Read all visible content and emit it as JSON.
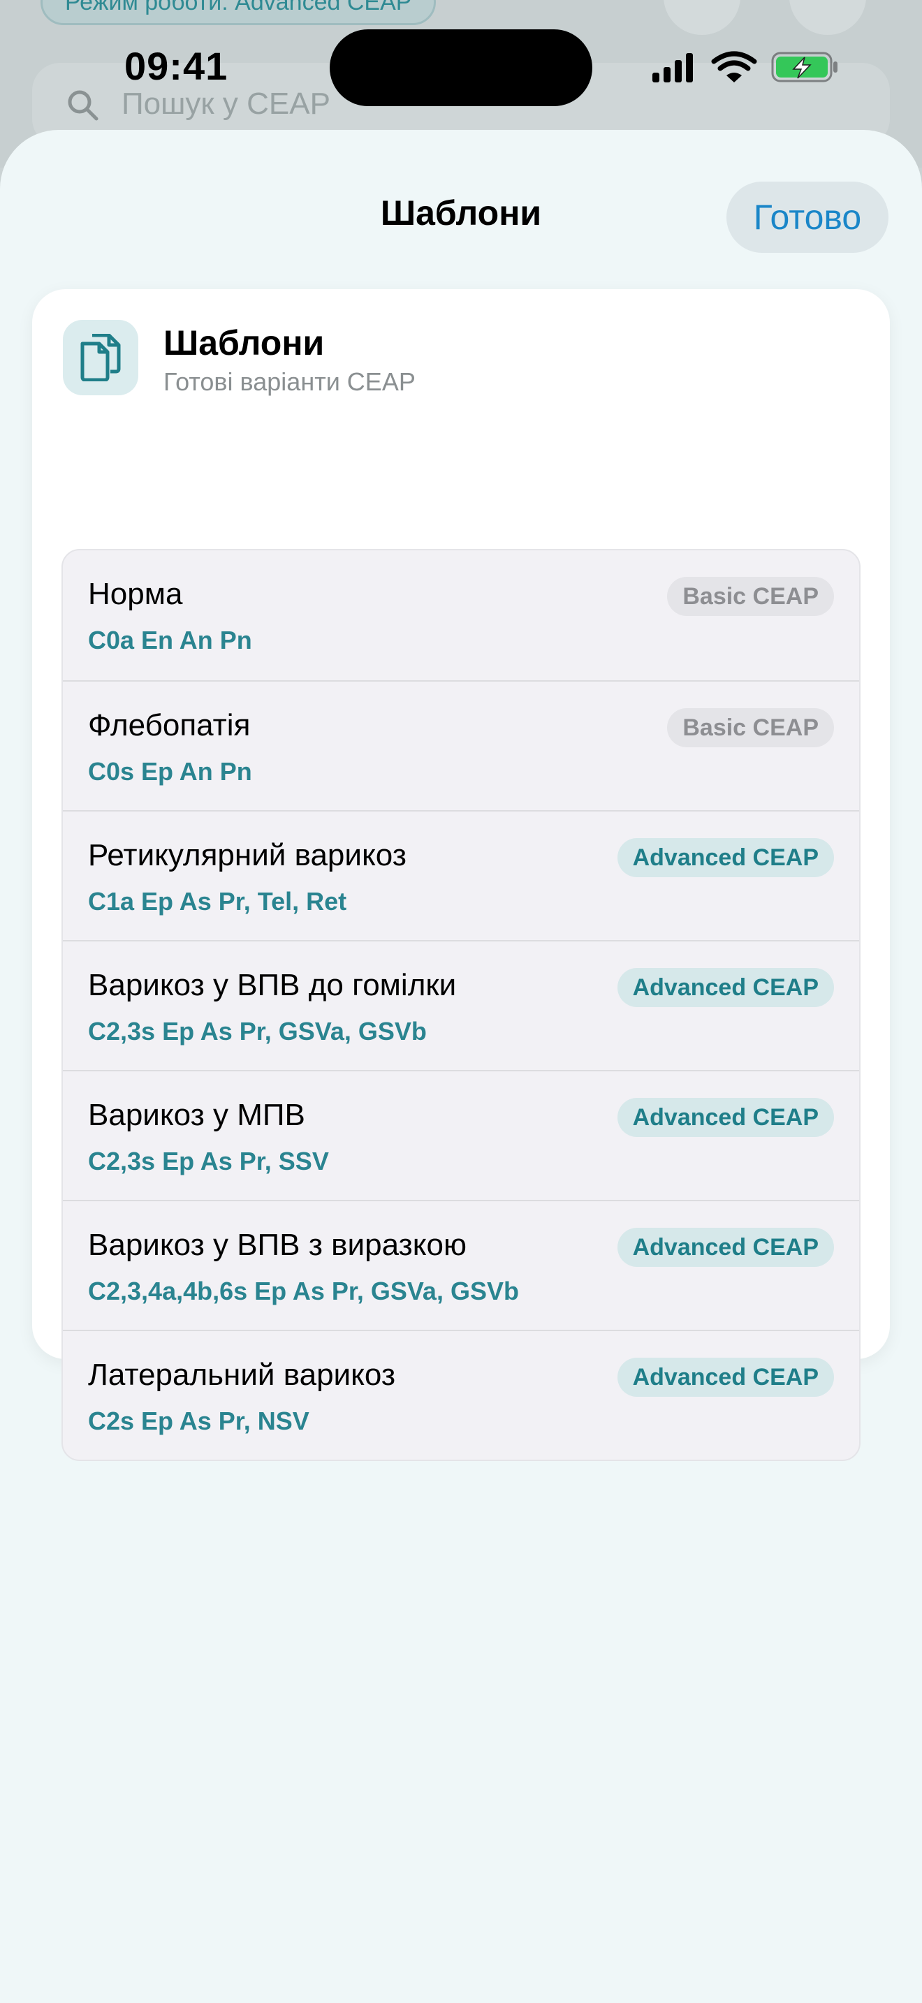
{
  "background": {
    "mode_pill": "Режим роботи: Advanced CEAP",
    "search_placeholder": "Пошук у CEAP"
  },
  "status_bar": {
    "time": "09:41"
  },
  "sheet": {
    "title": "Шаблони",
    "done_label": "Готово"
  },
  "card": {
    "icon": "documents-icon",
    "title": "Шаблони",
    "subtitle": "Готові варіанти CEAP"
  },
  "templates": [
    {
      "title": "Норма",
      "code": "C0a En An Pn",
      "badge": "Basic CEAP",
      "kind": "basic"
    },
    {
      "title": "Флебопатія",
      "code": "C0s Ep An Pn",
      "badge": "Basic CEAP",
      "kind": "basic"
    },
    {
      "title": "Ретикулярний варикоз",
      "code": "C1a Ep As Pr, Tel, Ret",
      "badge": "Advanced CEAP",
      "kind": "advanced"
    },
    {
      "title": "Варикоз у ВПВ до гомілки",
      "code": "C2,3s Ep As Pr, GSVa, GSVb",
      "badge": "Advanced CEAP",
      "kind": "advanced"
    },
    {
      "title": "Варикоз у МПВ",
      "code": "C2,3s Ep As Pr, SSV",
      "badge": "Advanced CEAP",
      "kind": "advanced"
    },
    {
      "title": "Варикоз у ВПВ з виразкою",
      "code": "C2,3,4a,4b,6s Ep As Pr, GSVa, GSVb",
      "badge": "Advanced CEAP",
      "kind": "advanced"
    },
    {
      "title": "Латеральний варикоз",
      "code": "C2s Ep As Pr, NSV",
      "badge": "Advanced CEAP",
      "kind": "advanced"
    }
  ],
  "colors": {
    "accent_teal": "#2a8490",
    "done_blue": "#1a86c8",
    "battery_green": "#34c759"
  }
}
